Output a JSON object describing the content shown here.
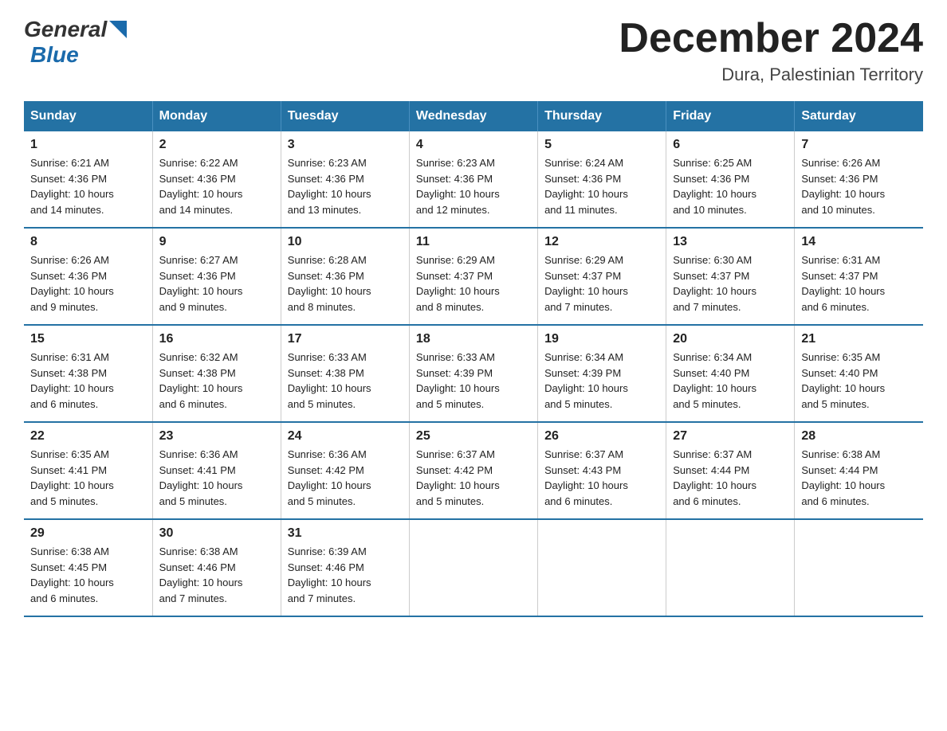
{
  "header": {
    "logo": {
      "general_text": "General",
      "blue_text": "Blue"
    },
    "title": "December 2024",
    "location": "Dura, Palestinian Territory"
  },
  "calendar": {
    "headers": [
      "Sunday",
      "Monday",
      "Tuesday",
      "Wednesday",
      "Thursday",
      "Friday",
      "Saturday"
    ],
    "weeks": [
      [
        {
          "day": "1",
          "sunrise": "6:21 AM",
          "sunset": "4:36 PM",
          "daylight": "10 hours and 14 minutes."
        },
        {
          "day": "2",
          "sunrise": "6:22 AM",
          "sunset": "4:36 PM",
          "daylight": "10 hours and 14 minutes."
        },
        {
          "day": "3",
          "sunrise": "6:23 AM",
          "sunset": "4:36 PM",
          "daylight": "10 hours and 13 minutes."
        },
        {
          "day": "4",
          "sunrise": "6:23 AM",
          "sunset": "4:36 PM",
          "daylight": "10 hours and 12 minutes."
        },
        {
          "day": "5",
          "sunrise": "6:24 AM",
          "sunset": "4:36 PM",
          "daylight": "10 hours and 11 minutes."
        },
        {
          "day": "6",
          "sunrise": "6:25 AM",
          "sunset": "4:36 PM",
          "daylight": "10 hours and 10 minutes."
        },
        {
          "day": "7",
          "sunrise": "6:26 AM",
          "sunset": "4:36 PM",
          "daylight": "10 hours and 10 minutes."
        }
      ],
      [
        {
          "day": "8",
          "sunrise": "6:26 AM",
          "sunset": "4:36 PM",
          "daylight": "10 hours and 9 minutes."
        },
        {
          "day": "9",
          "sunrise": "6:27 AM",
          "sunset": "4:36 PM",
          "daylight": "10 hours and 9 minutes."
        },
        {
          "day": "10",
          "sunrise": "6:28 AM",
          "sunset": "4:36 PM",
          "daylight": "10 hours and 8 minutes."
        },
        {
          "day": "11",
          "sunrise": "6:29 AM",
          "sunset": "4:37 PM",
          "daylight": "10 hours and 8 minutes."
        },
        {
          "day": "12",
          "sunrise": "6:29 AM",
          "sunset": "4:37 PM",
          "daylight": "10 hours and 7 minutes."
        },
        {
          "day": "13",
          "sunrise": "6:30 AM",
          "sunset": "4:37 PM",
          "daylight": "10 hours and 7 minutes."
        },
        {
          "day": "14",
          "sunrise": "6:31 AM",
          "sunset": "4:37 PM",
          "daylight": "10 hours and 6 minutes."
        }
      ],
      [
        {
          "day": "15",
          "sunrise": "6:31 AM",
          "sunset": "4:38 PM",
          "daylight": "10 hours and 6 minutes."
        },
        {
          "day": "16",
          "sunrise": "6:32 AM",
          "sunset": "4:38 PM",
          "daylight": "10 hours and 6 minutes."
        },
        {
          "day": "17",
          "sunrise": "6:33 AM",
          "sunset": "4:38 PM",
          "daylight": "10 hours and 5 minutes."
        },
        {
          "day": "18",
          "sunrise": "6:33 AM",
          "sunset": "4:39 PM",
          "daylight": "10 hours and 5 minutes."
        },
        {
          "day": "19",
          "sunrise": "6:34 AM",
          "sunset": "4:39 PM",
          "daylight": "10 hours and 5 minutes."
        },
        {
          "day": "20",
          "sunrise": "6:34 AM",
          "sunset": "4:40 PM",
          "daylight": "10 hours and 5 minutes."
        },
        {
          "day": "21",
          "sunrise": "6:35 AM",
          "sunset": "4:40 PM",
          "daylight": "10 hours and 5 minutes."
        }
      ],
      [
        {
          "day": "22",
          "sunrise": "6:35 AM",
          "sunset": "4:41 PM",
          "daylight": "10 hours and 5 minutes."
        },
        {
          "day": "23",
          "sunrise": "6:36 AM",
          "sunset": "4:41 PM",
          "daylight": "10 hours and 5 minutes."
        },
        {
          "day": "24",
          "sunrise": "6:36 AM",
          "sunset": "4:42 PM",
          "daylight": "10 hours and 5 minutes."
        },
        {
          "day": "25",
          "sunrise": "6:37 AM",
          "sunset": "4:42 PM",
          "daylight": "10 hours and 5 minutes."
        },
        {
          "day": "26",
          "sunrise": "6:37 AM",
          "sunset": "4:43 PM",
          "daylight": "10 hours and 6 minutes."
        },
        {
          "day": "27",
          "sunrise": "6:37 AM",
          "sunset": "4:44 PM",
          "daylight": "10 hours and 6 minutes."
        },
        {
          "day": "28",
          "sunrise": "6:38 AM",
          "sunset": "4:44 PM",
          "daylight": "10 hours and 6 minutes."
        }
      ],
      [
        {
          "day": "29",
          "sunrise": "6:38 AM",
          "sunset": "4:45 PM",
          "daylight": "10 hours and 6 minutes."
        },
        {
          "day": "30",
          "sunrise": "6:38 AM",
          "sunset": "4:46 PM",
          "daylight": "10 hours and 7 minutes."
        },
        {
          "day": "31",
          "sunrise": "6:39 AM",
          "sunset": "4:46 PM",
          "daylight": "10 hours and 7 minutes."
        },
        null,
        null,
        null,
        null
      ]
    ],
    "labels": {
      "sunrise": "Sunrise:",
      "sunset": "Sunset:",
      "daylight": "Daylight:"
    }
  }
}
